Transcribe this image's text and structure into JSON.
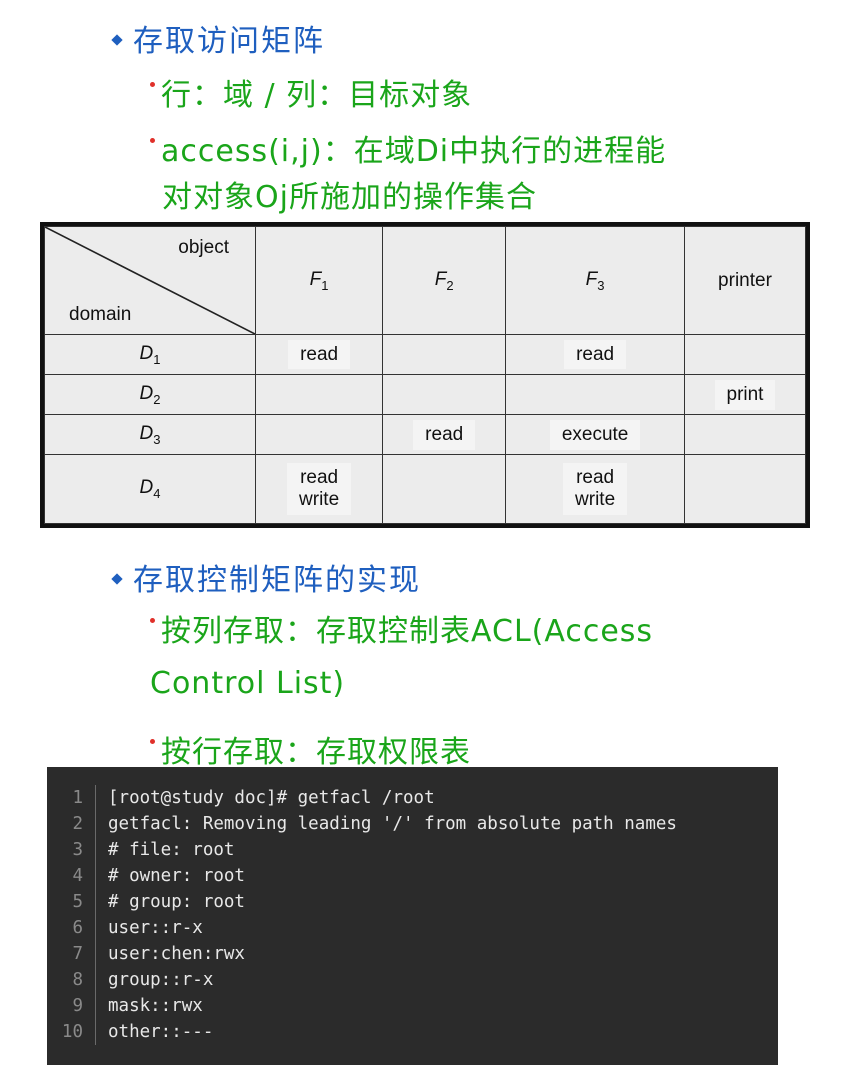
{
  "headings": [
    {
      "type": "h1",
      "text": "存取访问矩阵"
    },
    {
      "type": "h2",
      "text": "行：域   /     列：目标对象"
    },
    {
      "type": "h2",
      "text": "access(i,j)：在域Di中执行的进程能"
    },
    {
      "type": "h2cont",
      "text": "对对象Oj所施加的操作集合"
    }
  ],
  "matrix": {
    "corner_object": "object",
    "corner_domain": "domain",
    "columns": [
      {
        "base": "F",
        "sub": "1"
      },
      {
        "base": "F",
        "sub": "2"
      },
      {
        "base": "F",
        "sub": "3"
      },
      {
        "plain": "printer"
      }
    ],
    "rows": [
      {
        "base": "D",
        "sub": "1",
        "cells": [
          "read",
          "",
          "read",
          ""
        ]
      },
      {
        "base": "D",
        "sub": "2",
        "cells": [
          "",
          "",
          "",
          "print"
        ]
      },
      {
        "base": "D",
        "sub": "3",
        "cells": [
          "",
          "read",
          "execute",
          ""
        ]
      },
      {
        "base": "D",
        "sub": "4",
        "cells": [
          "read\nwrite",
          "",
          "read\nwrite",
          ""
        ]
      }
    ]
  },
  "section2": {
    "title": "存取控制矩阵的实现",
    "item1_line1": "按列存取：存取控制表ACL(Access",
    "item1_line2": "Control List)",
    "item2": "按行存取：存取权限表"
  },
  "code": {
    "lines": [
      "[root@study doc]# getfacl /root",
      "getfacl: Removing leading '/' from absolute path names",
      "# file: root",
      "# owner: root",
      "# group: root",
      "user::r-x",
      "user:chen:rwx",
      "group::r-x",
      "mask::rwx",
      "other::---"
    ],
    "line_numbers": [
      "1",
      "2",
      "3",
      "4",
      "5",
      "6",
      "7",
      "8",
      "9",
      "10"
    ]
  },
  "colors": {
    "heading_blue": "#1f5fbf",
    "text_green": "#1aa51a",
    "bullet_red": "#e0302a",
    "code_bg": "#2b2b2b"
  }
}
